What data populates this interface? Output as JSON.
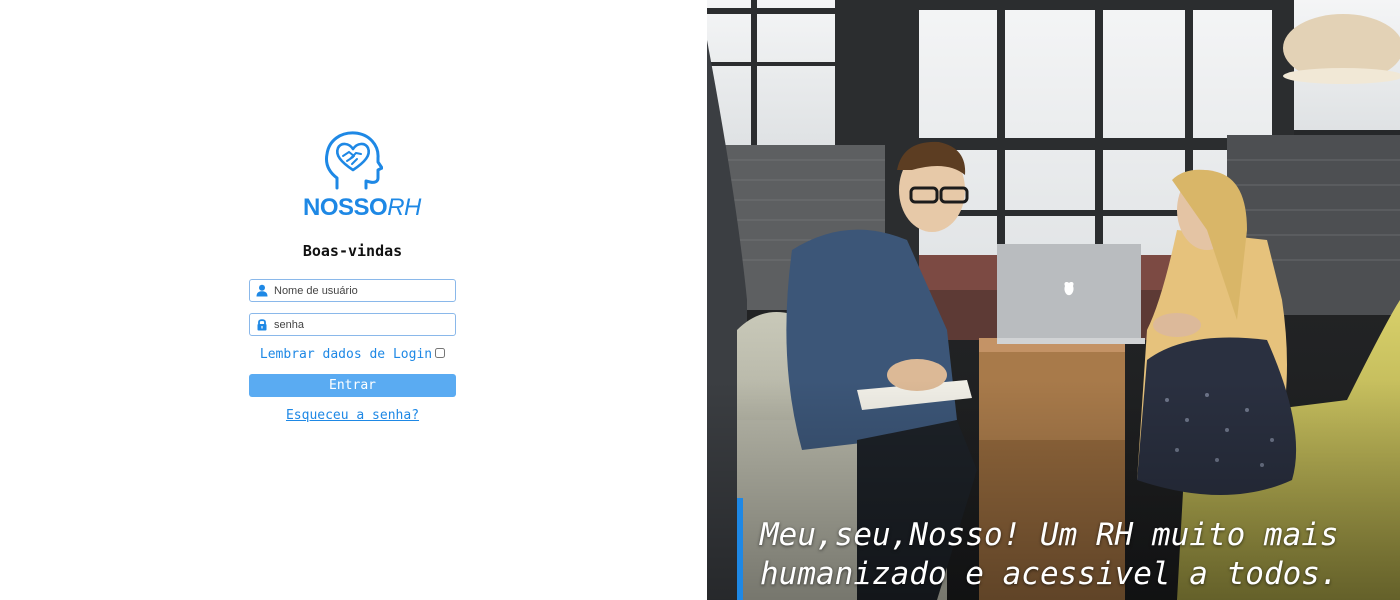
{
  "brand": {
    "name_bold": "NOSSO",
    "name_italic": "RH",
    "color": "#1e88e5"
  },
  "login": {
    "welcome": "Boas-vindas",
    "username": {
      "placeholder": "Nome de usuário",
      "value": ""
    },
    "password": {
      "placeholder": "senha",
      "value": ""
    },
    "remember_label": "Lembrar dados de Login",
    "submit_label": "Entrar",
    "forgot_label": "Esqueceu a senha?"
  },
  "hero": {
    "slogan_line1": "Meu,seu,Nosso! Um RH muito mais",
    "slogan_line2": "humanizado e acessivel a todos.",
    "accent_color": "#1e88e5"
  },
  "icons": {
    "user": "user-icon",
    "lock": "lock-icon",
    "logo": "head-heart-handshake-logo"
  }
}
